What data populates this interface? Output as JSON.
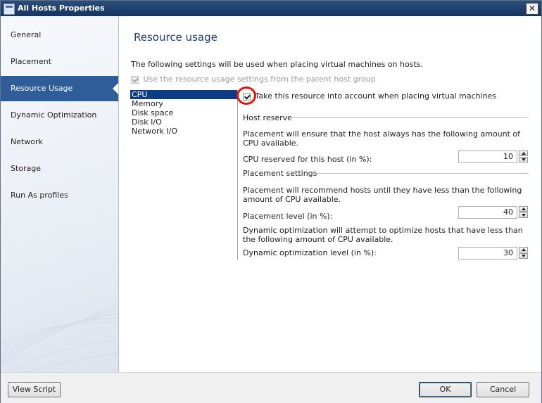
{
  "window": {
    "title": "All Hosts Properties"
  },
  "sidebar": {
    "items": [
      {
        "label": "General"
      },
      {
        "label": "Placement"
      },
      {
        "label": "Resource Usage"
      },
      {
        "label": "Dynamic Optimization"
      },
      {
        "label": "Network"
      },
      {
        "label": "Storage"
      },
      {
        "label": "Run As profiles"
      }
    ],
    "active_index": 2
  },
  "main": {
    "heading": "Resource usage",
    "intro": "The following settings will be used when placing virtual machines on hosts.",
    "use_parent_label": "Use the resource usage settings from the parent host group",
    "use_parent_checked": true,
    "resources": [
      "CPU",
      "Memory",
      "Disk space",
      "Disk I/O",
      "Network I/O"
    ],
    "selected_resource": "CPU",
    "take_into_account_label": "Take this resource into account when placing virtual machines",
    "take_into_account_checked": true,
    "host_reserve": {
      "group_label": "Host reserve",
      "description": "Placement will ensure that the host always has the following amount of CPU available.",
      "field_label": "CPU reserved for this host (in %):",
      "value": "10"
    },
    "placement_settings": {
      "group_label": "Placement settings",
      "description": "Placement will recommend hosts until they have less than the following amount of CPU available.",
      "placement_level_label": "Placement level (in %):",
      "placement_level_value": "40",
      "dynamic_description": "Dynamic optimization will attempt to optimize hosts that have less than the following amount of CPU available.",
      "dynamic_level_label": "Dynamic optimization level (in %):",
      "dynamic_level_value": "30"
    }
  },
  "footer": {
    "view_script_label": "View Script",
    "ok_label": "OK",
    "cancel_label": "Cancel"
  },
  "colors": {
    "title_bar": "#1f4170",
    "nav_active": "#2f5d99",
    "list_selected": "#0e3c84",
    "heading": "#1f3f70",
    "annotation_circle": "#e5120c"
  }
}
